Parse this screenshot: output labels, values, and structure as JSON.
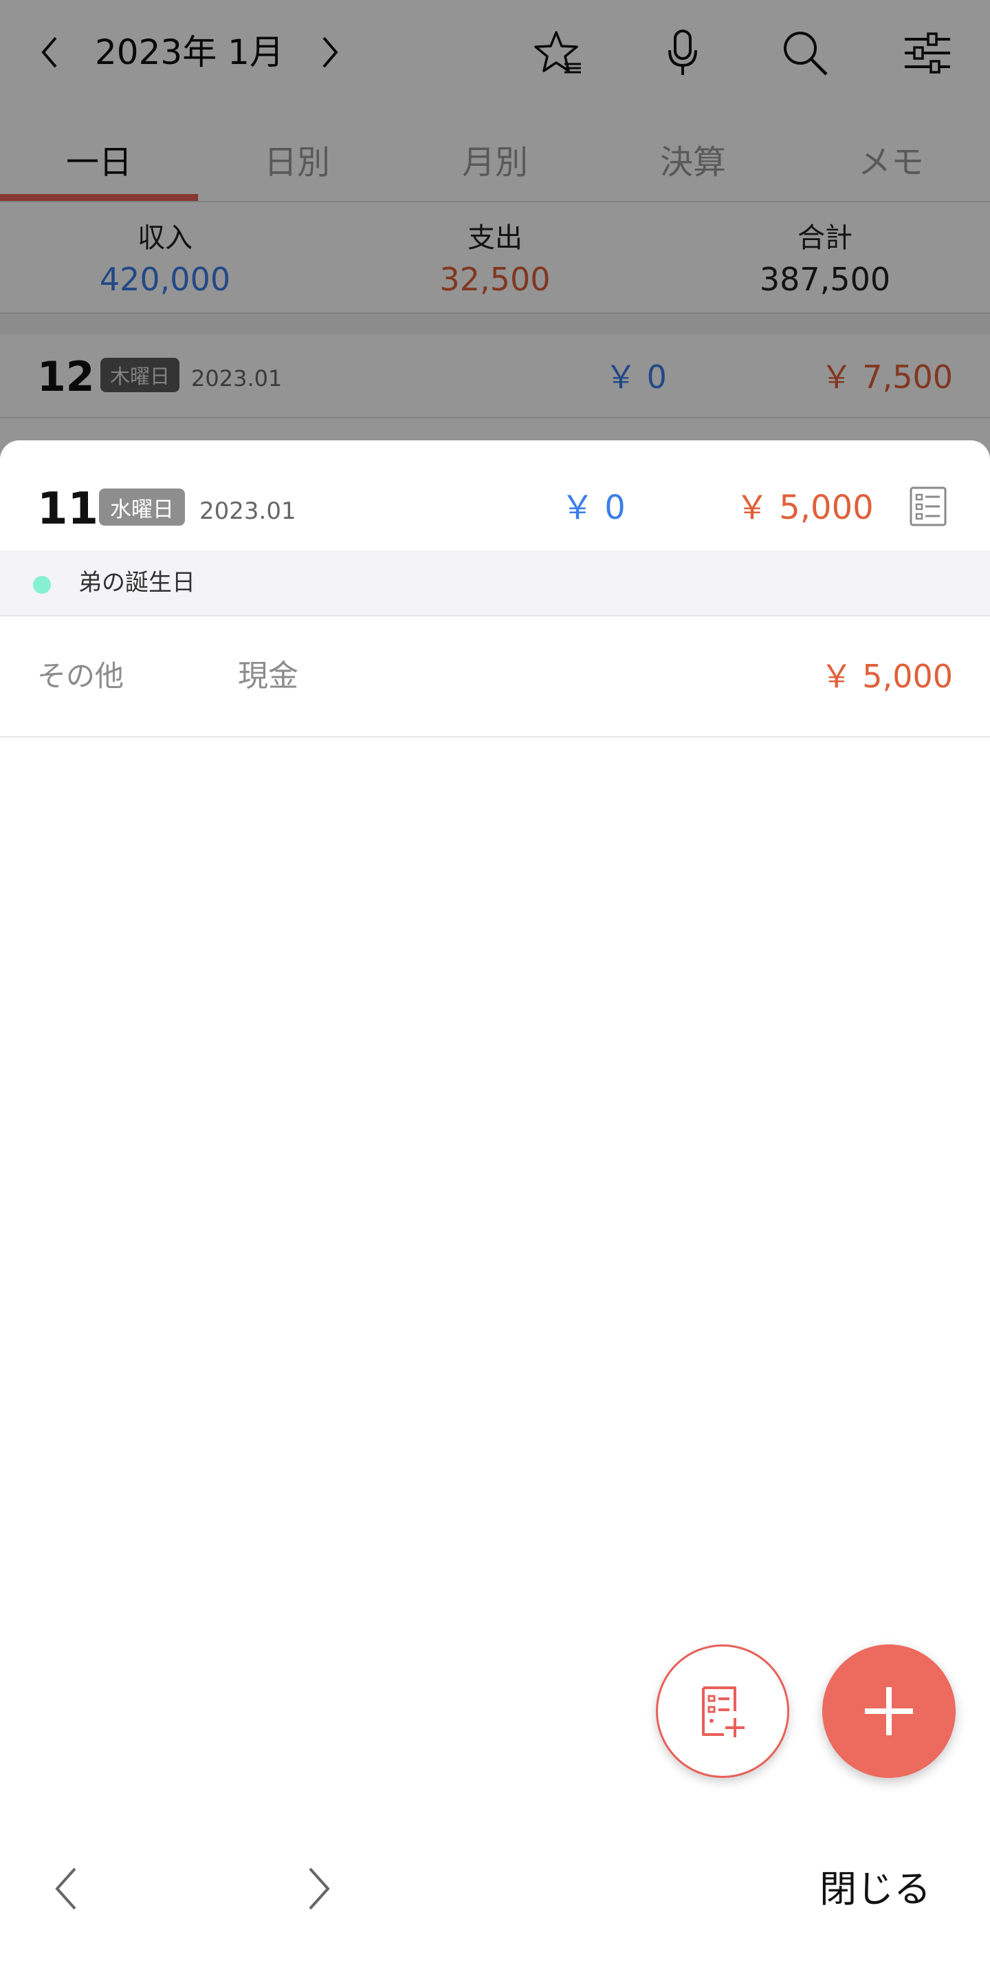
{
  "header": {
    "month_title": "2023年 1月",
    "icons": [
      "chevron-left-icon",
      "chevron-right-icon",
      "star-list-icon",
      "microphone-icon",
      "search-icon",
      "sliders-icon"
    ]
  },
  "tabs": [
    {
      "label": "一日",
      "active": true
    },
    {
      "label": "日別",
      "active": false
    },
    {
      "label": "月別",
      "active": false
    },
    {
      "label": "決算",
      "active": false
    },
    {
      "label": "メモ",
      "active": false
    }
  ],
  "summary": {
    "income_label": "収入",
    "income_value": "420,000",
    "expense_label": "支出",
    "expense_value": "32,500",
    "total_label": "合計",
    "total_value": "387,500"
  },
  "background_row": {
    "day": "12",
    "weekday": "木曜日",
    "date": "2023.01",
    "income": "￥ 0",
    "expense": "￥ 7,500"
  },
  "sheet": {
    "day": "11",
    "weekday": "水曜日",
    "date": "2023.01",
    "income": "￥ 0",
    "expense": "￥ 5,000",
    "memo": "弟の誕生日",
    "transactions": [
      {
        "category": "その他",
        "account": "現金",
        "amount": "￥ 5,000"
      }
    ],
    "close_label": "閉じる"
  },
  "colors": {
    "accent": "#e8605a",
    "income": "#3c7ee8",
    "expense": "#e0603a",
    "memo_dot": "#86f0d2"
  }
}
